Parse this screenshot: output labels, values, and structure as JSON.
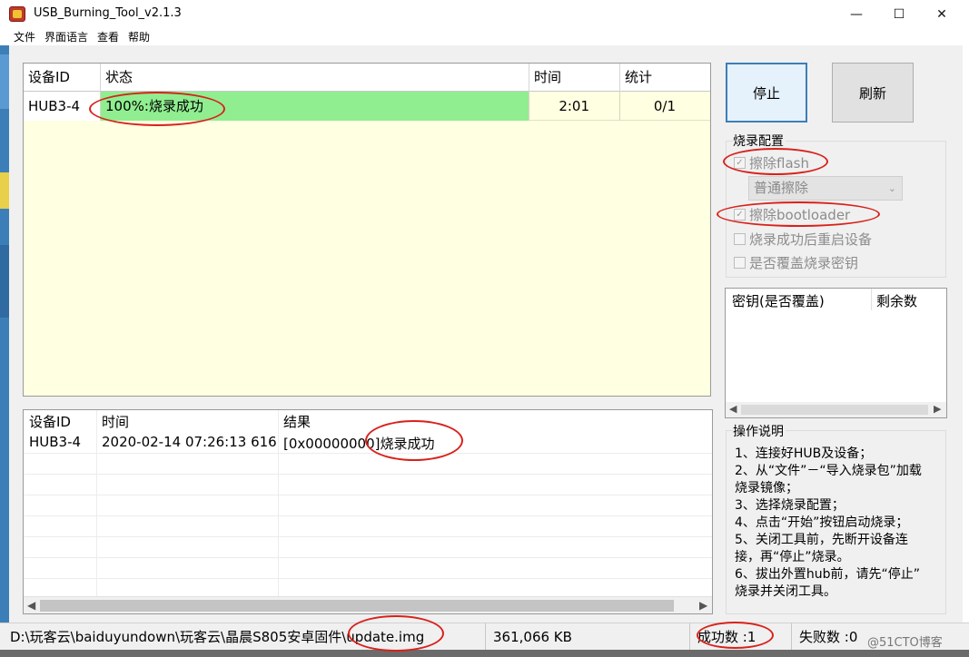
{
  "window": {
    "title": "USB_Burning_Tool_v2.1.3",
    "controls": {
      "minimize": "—",
      "maximize": "☐",
      "close": "✕"
    }
  },
  "menu": [
    "文件",
    "界面语言",
    "查看",
    "帮助"
  ],
  "device_table": {
    "headers": [
      "设备ID",
      "状态",
      "时间",
      "统计"
    ],
    "rows": [
      {
        "id": "HUB3-4",
        "status": "100%:烧录成功",
        "time": "2:01",
        "stats": "0/1"
      }
    ],
    "status_color": "#90ee90"
  },
  "log_table": {
    "headers": [
      "设备ID",
      "时间",
      "结果"
    ],
    "rows": [
      {
        "id": "HUB3-4",
        "time": "2020-02-14 07:26:13 616",
        "result": "[0x00000000]烧录成功"
      }
    ]
  },
  "buttons": {
    "stop": "停止",
    "refresh": "刷新"
  },
  "burn_config": {
    "title": "烧录配置",
    "erase_flash": {
      "label": "擦除flash",
      "checked": true
    },
    "erase_mode": "普通擦除",
    "erase_bootloader": {
      "label": "擦除bootloader",
      "checked": true
    },
    "reboot_after": {
      "label": "烧录成功后重启设备",
      "checked": false
    },
    "overwrite_key": {
      "label": "是否覆盖烧录密钥",
      "checked": false
    }
  },
  "key_table": {
    "headers": [
      "密钥(是否覆盖)",
      "剩余数"
    ]
  },
  "instructions": {
    "title": "操作说明",
    "lines": [
      "1、连接好HUB及设备；",
      "2、从“文件”－“导入烧录包”加载",
      "烧录镜像；",
      "3、选择烧录配置；",
      "4、点击“开始”按钮启动烧录；",
      "5、关闭工具前，先断开设备连",
      "接，再“停止”烧录。",
      "6、拔出外置hub前，请先“停止”",
      "烧录并关闭工具。"
    ]
  },
  "statusbar": {
    "path": "D:\\玩客云\\baiduyundown\\玩客云\\晶晨S805安卓固件\\update.img",
    "size": "361,066 KB",
    "success": "成功数 :1",
    "fail": "失败数 :0"
  },
  "watermark": "@51CTO博客",
  "annotation_color": "#d8211b"
}
